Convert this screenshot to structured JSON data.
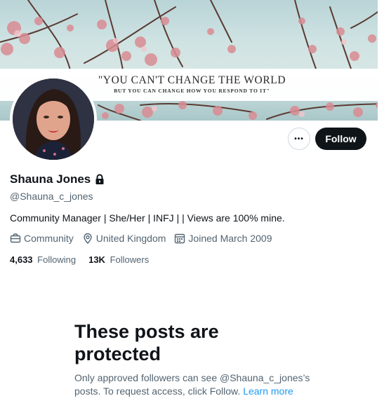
{
  "banner": {
    "quote_main": "\"YOU CAN'T CHANGE THE WORLD",
    "quote_sub": "BUT YOU CAN CHANGE HOW YOU RESPOND TO IT\""
  },
  "actions": {
    "more_label": "•••",
    "follow_label": "Follow"
  },
  "profile": {
    "display_name": "Shauna Jones",
    "handle": "@Shauna_c_jones",
    "bio": "Community Manager | She/Her | INFJ | | Views are 100% mine.",
    "category": "Community",
    "location": "United Kingdom",
    "joined": "Joined March 2009"
  },
  "stats": {
    "following_count": "4,633",
    "following_label": "Following",
    "followers_count": "13K",
    "followers_label": "Followers"
  },
  "protected": {
    "title": "These posts are protected",
    "message": "Only approved followers can see @Shauna_c_jones’s posts. To request access, click Follow.",
    "learn_more": "Learn more"
  },
  "colors": {
    "primary_text": "#0f1419",
    "secondary_text": "#536471",
    "link": "#1d9bf0",
    "follow_button_bg": "#0f1419"
  },
  "icons": {
    "lock": "lock-icon",
    "category": "briefcase-icon",
    "location": "location-pin-icon",
    "joined": "calendar-icon",
    "more": "more-dots-icon"
  }
}
